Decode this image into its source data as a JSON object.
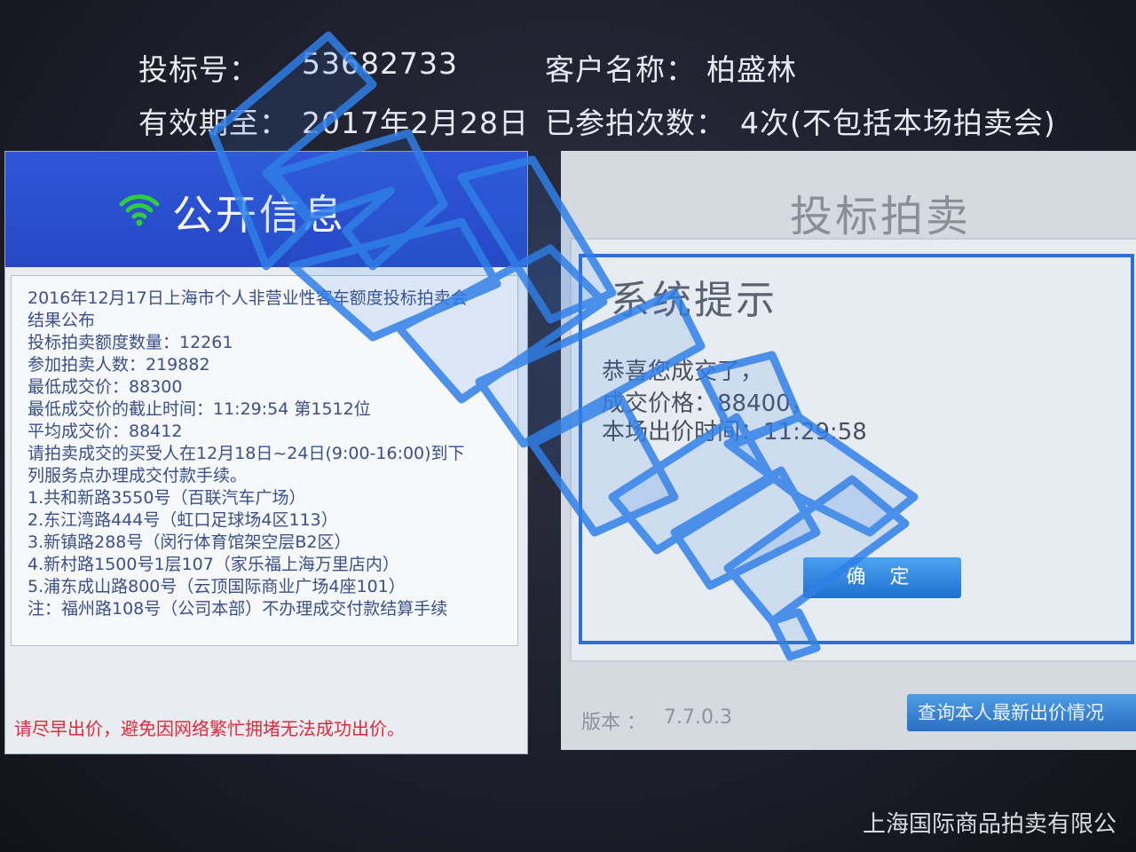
{
  "header": {
    "bid_no_label": "投标号：",
    "bid_no": "53682733",
    "client_label": "客户名称：",
    "client_name": "柏盛林",
    "valid_label": "有效期至：",
    "valid_until": "2017年2月28日",
    "count_label": "已参拍次数：",
    "count_value": "4次(不包括本场拍卖会)"
  },
  "left_panel": {
    "title": "公开信息",
    "icon": "wifi-icon",
    "lines": [
      "2016年12月17日上海市个人非营业性客车额度投标拍卖会",
      "结果公布",
      "投标拍卖额度数量：12261",
      "参加拍卖人数：219882",
      "最低成交价：88300",
      "最低成交价的截止时间：11:29:54 第1512位",
      "平均成交价：88412",
      "请拍卖成交的买受人在12月18日~24日(9:00-16:00)到下",
      "列服务点办理成交付款手续。",
      "1.共和新路3550号（百联汽车广场）",
      "2.东江湾路444号（虹口足球场4区113）",
      "3.新镇路288号（闵行体育馆架空层B2区）",
      "4.新村路1500号1层107（家乐福上海万里店内）",
      "5.浦东成山路800号（云顶国际商业广场4座101）",
      "注：福州路108号（公司本部）不办理成交付款结算手续"
    ],
    "warning": "请尽早出价，避免因网络繁忙拥堵无法成功出价。"
  },
  "right_panel": {
    "title": "投标拍卖",
    "dialog": {
      "title": "系统提示",
      "line1": "恭喜您成交了，",
      "line2": "成交价格：88400，",
      "line3": "本场出价时间：11:29:58",
      "confirm_label": "确 定"
    },
    "version_label": "版本 ：",
    "version_value": "7.7.0.3",
    "query_button_label": "查询本人最新出价情况"
  },
  "footer": {
    "company": "上海国际商品拍卖有限公"
  },
  "colors": {
    "header_blue": "#2548c6",
    "dialog_border": "#2d6fd8",
    "warning_red": "#e3283a",
    "button_blue": "#1f6fd0",
    "watermark_blue": "#2f7fe8"
  }
}
